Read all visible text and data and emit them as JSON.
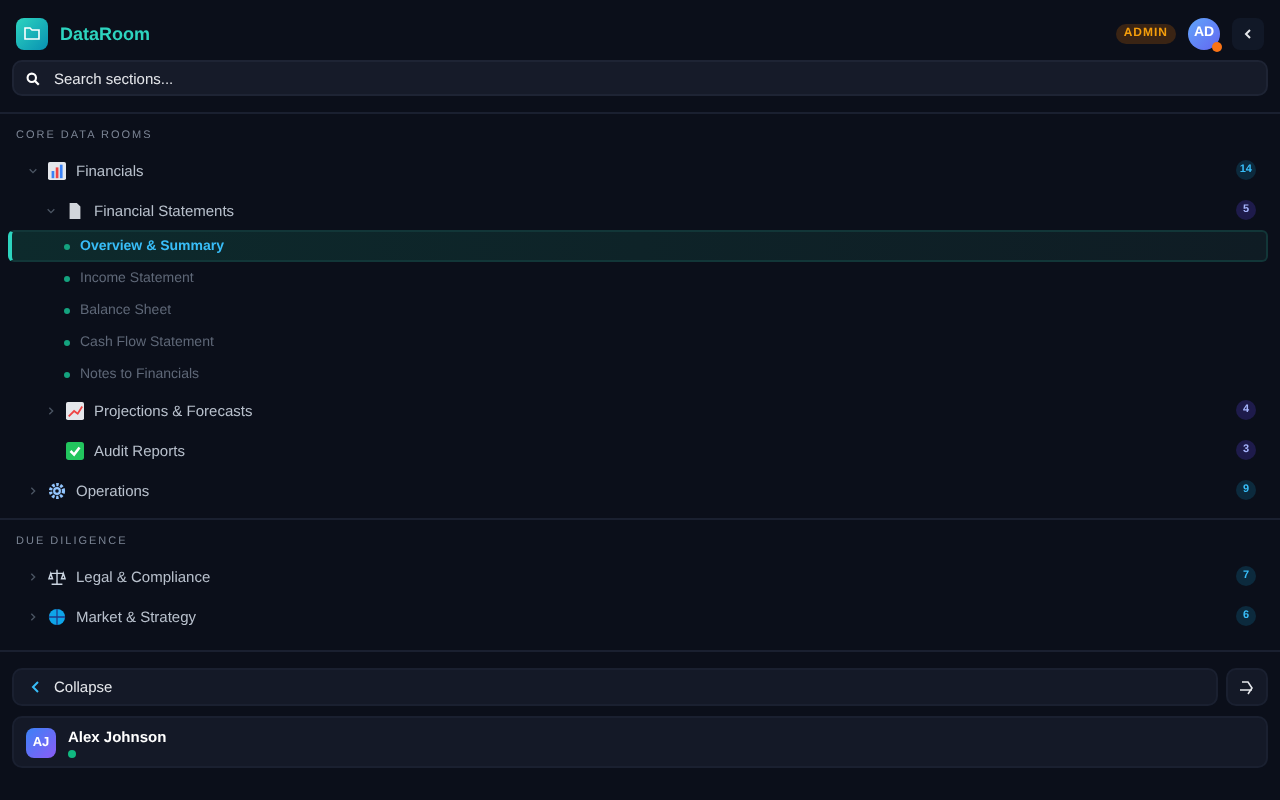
{
  "brand": {
    "title": "DataRoom"
  },
  "header": {
    "role_badge": "ADMIN",
    "avatar": "AD",
    "avatar_status": {
      "color": "#f97316"
    }
  },
  "search": {
    "placeholder": "Search sections..."
  },
  "sections": [
    {
      "label": "CORE DATA ROOMS",
      "items": [
        {
          "label": "Financials",
          "kind": "chart",
          "count": "14",
          "expanded": true,
          "children": [
            {
              "label": "Financial Statements",
              "kind": "document",
              "count": "5",
              "expanded": true,
              "children": [
                {
                  "label": "Overview & Summary",
                  "kind": "leaf",
                  "selected": true
                },
                {
                  "label": "Income Statement",
                  "kind": "leaf",
                  "selected": false
                },
                {
                  "label": "Balance Sheet",
                  "kind": "leaf",
                  "selected": false
                },
                {
                  "label": "Cash Flow Statement",
                  "kind": "leaf",
                  "selected": false
                },
                {
                  "label": "Notes to Financials",
                  "kind": "leaf",
                  "selected": false
                }
              ]
            },
            {
              "label": "Projections & Forecasts",
              "kind": "trend",
              "count": "4",
              "expanded": false
            },
            {
              "label": "Audit Reports",
              "kind": "check",
              "count": "3"
            }
          ]
        },
        {
          "label": "Operations",
          "kind": "gear",
          "count": "9",
          "expanded": false
        }
      ]
    },
    {
      "label": "DUE DILIGENCE",
      "items": [
        {
          "label": "Legal & Compliance",
          "kind": "scales",
          "count": "7",
          "expanded": false
        },
        {
          "label": "Market & Strategy",
          "kind": "globe",
          "count": "6",
          "expanded": false
        }
      ]
    }
  ],
  "footer": {
    "collapse_label": "Collapse",
    "user": {
      "initials": "AJ",
      "name": "Alex Johnson",
      "status": {
        "color": "#10b981"
      }
    }
  }
}
